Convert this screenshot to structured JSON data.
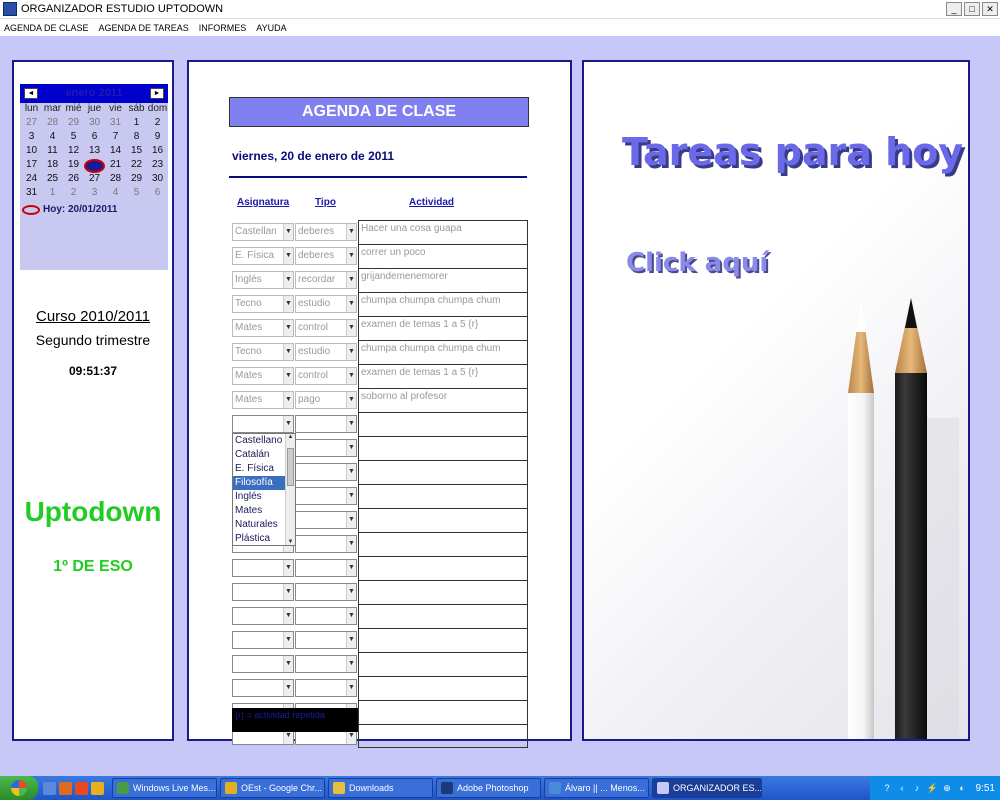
{
  "window": {
    "title": "ORGANIZADOR ESTUDIO UPTODOWN",
    "buttons": {
      "minimize": "_",
      "maximize": "□",
      "close": "✕"
    }
  },
  "menu": [
    "AGENDA DE CLASE",
    "AGENDA DE TAREAS",
    "INFORMES",
    "AYUDA"
  ],
  "calendar": {
    "month_label": "enero 2011",
    "prev": "◄",
    "next": "►",
    "weekdays": [
      "lun",
      "mar",
      "mié",
      "jue",
      "vie",
      "sáb",
      "dom"
    ],
    "days": [
      {
        "d": "27",
        "o": true
      },
      {
        "d": "28",
        "o": true
      },
      {
        "d": "29",
        "o": true
      },
      {
        "d": "30",
        "o": true
      },
      {
        "d": "31",
        "o": true
      },
      {
        "d": "1"
      },
      {
        "d": "2"
      },
      {
        "d": "3"
      },
      {
        "d": "4"
      },
      {
        "d": "5"
      },
      {
        "d": "6"
      },
      {
        "d": "7"
      },
      {
        "d": "8"
      },
      {
        "d": "9"
      },
      {
        "d": "10"
      },
      {
        "d": "11"
      },
      {
        "d": "12"
      },
      {
        "d": "13"
      },
      {
        "d": "14"
      },
      {
        "d": "15"
      },
      {
        "d": "16"
      },
      {
        "d": "17"
      },
      {
        "d": "18"
      },
      {
        "d": "19"
      },
      {
        "d": "20",
        "t": true
      },
      {
        "d": "21"
      },
      {
        "d": "22"
      },
      {
        "d": "23"
      },
      {
        "d": "24"
      },
      {
        "d": "25"
      },
      {
        "d": "26"
      },
      {
        "d": "27"
      },
      {
        "d": "28"
      },
      {
        "d": "29"
      },
      {
        "d": "30"
      },
      {
        "d": "31"
      },
      {
        "d": "1",
        "o": true
      },
      {
        "d": "2",
        "o": true
      },
      {
        "d": "3",
        "o": true
      },
      {
        "d": "4",
        "o": true
      },
      {
        "d": "5",
        "o": true
      },
      {
        "d": "6",
        "o": true
      }
    ],
    "today_label": "Hoy: 20/01/2011"
  },
  "left": {
    "course": "Curso 2010/2011",
    "term": "Segundo trimestre",
    "clock": "09:51:37",
    "brand": "Uptodown",
    "grade": "1º DE ESO"
  },
  "agenda": {
    "title": "AGENDA DE CLASE",
    "date": "viernes,  20 de enero de 2011",
    "headers": {
      "asignatura": "Asignatura",
      "tipo": "Tipo",
      "actividad": "Actividad"
    },
    "rows": [
      {
        "asignatura": "Castellan",
        "tipo": "deberes",
        "actividad": "Hacer una cosa guapa"
      },
      {
        "asignatura": "E. Física",
        "tipo": "deberes",
        "actividad": "correr un poco"
      },
      {
        "asignatura": "Inglés",
        "tipo": "recordar",
        "actividad": "grijandemenemorer"
      },
      {
        "asignatura": "Tecno",
        "tipo": "estudio",
        "actividad": "chumpa chumpa chumpa chum"
      },
      {
        "asignatura": "Mates",
        "tipo": "control",
        "actividad": "examen de temas 1 a 5 {r}"
      },
      {
        "asignatura": "Tecno",
        "tipo": "estudio",
        "actividad": "chumpa chumpa chumpa chum"
      },
      {
        "asignatura": "Mates",
        "tipo": "control",
        "actividad": "examen de temas 1 a 5 {r}"
      },
      {
        "asignatura": "Mates",
        "tipo": "pago",
        "actividad": "soborno al profesor"
      },
      {
        "asignatura": "",
        "tipo": "",
        "actividad": ""
      },
      {
        "asignatura": "",
        "tipo": "",
        "actividad": ""
      },
      {
        "asignatura": "",
        "tipo": "",
        "actividad": ""
      },
      {
        "asignatura": "",
        "tipo": "",
        "actividad": ""
      },
      {
        "asignatura": "",
        "tipo": "",
        "actividad": ""
      },
      {
        "asignatura": "",
        "tipo": "",
        "actividad": ""
      },
      {
        "asignatura": "",
        "tipo": "",
        "actividad": ""
      },
      {
        "asignatura": "",
        "tipo": "",
        "actividad": ""
      },
      {
        "asignatura": "",
        "tipo": "",
        "actividad": ""
      },
      {
        "asignatura": "",
        "tipo": "",
        "actividad": ""
      },
      {
        "asignatura": "",
        "tipo": "",
        "actividad": ""
      },
      {
        "asignatura": "",
        "tipo": "",
        "actividad": ""
      },
      {
        "asignatura": "",
        "tipo": "",
        "actividad": ""
      },
      {
        "asignatura": "",
        "tipo": "",
        "actividad": ""
      }
    ],
    "dropdown_options": [
      "Castellano",
      "Catalán",
      "E. Física",
      "Filosofía",
      "Inglés",
      "Mates",
      "Naturales",
      "Plástica"
    ],
    "dropdown_selected_index": 3,
    "legend": "{r} = actividad repetida"
  },
  "right": {
    "title": "Tareas para hoy",
    "click": "Click aquí"
  },
  "taskbar": {
    "items": [
      {
        "label": "Windows Live Mes...",
        "color": "#4a9a4a",
        "width": 105
      },
      {
        "label": "OEst - Google Chr...",
        "color": "#e0b020",
        "width": 105
      },
      {
        "label": "Downloads",
        "color": "#e8c040",
        "width": 105
      },
      {
        "label": "Adobe Photoshop",
        "color": "#1a3a7a",
        "width": 105
      },
      {
        "label": "Álvaro || ... Menos...",
        "color": "#4a8ad8",
        "width": 105
      },
      {
        "label": "ORGANIZADOR ES...",
        "color": "#c8c8f8",
        "width": 110,
        "active": true
      }
    ],
    "quick_colors": [
      "#5a8ad8",
      "#e06a20",
      "#e84a20",
      "#e8b020"
    ],
    "tray_icons": [
      "?",
      "‹",
      "♪",
      "⚡",
      "⊕",
      "◐"
    ],
    "time": "9:51"
  }
}
